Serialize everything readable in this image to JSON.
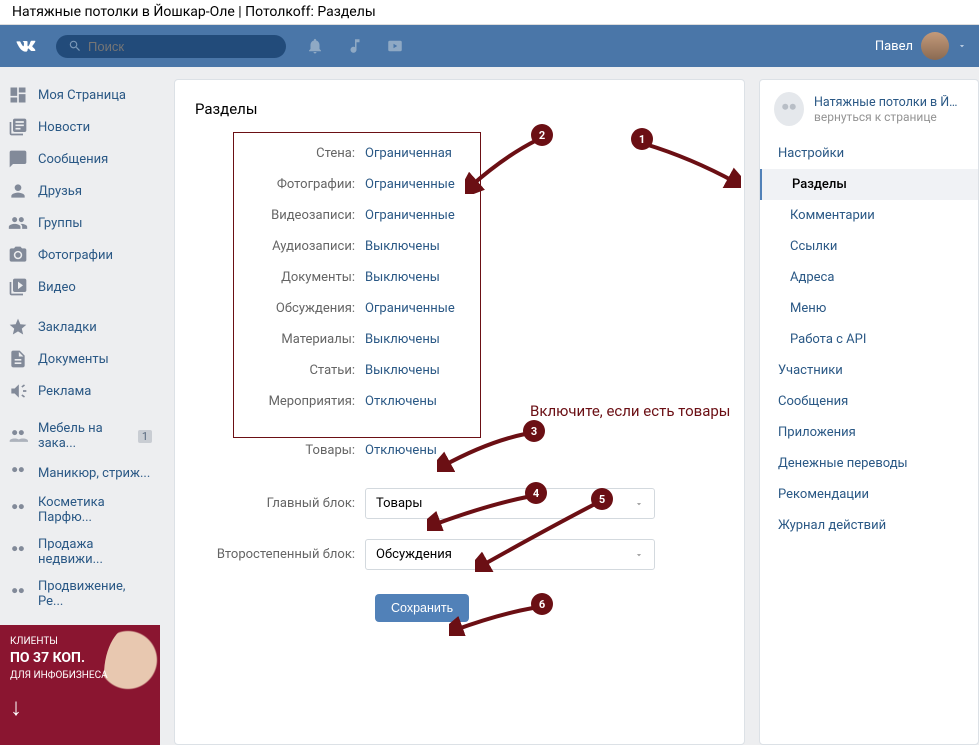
{
  "browser_title": "Натяжные потолки в Йошкар-Оле | Потолкоff: Разделы",
  "topbar": {
    "search_placeholder": "Поиск",
    "username": "Павел"
  },
  "leftnav": {
    "primary": [
      "Моя Страница",
      "Новости",
      "Сообщения",
      "Друзья",
      "Группы",
      "Фотографии",
      "Видео"
    ],
    "secondary": [
      "Закладки",
      "Документы",
      "Реклама"
    ],
    "groups": [
      {
        "label": "Мебель на зака...",
        "badge": "1"
      },
      {
        "label": "Маникюр, стриж..."
      },
      {
        "label": "Косметика Парфю..."
      },
      {
        "label": "Продажа недвижи..."
      },
      {
        "label": "Продвижение, Ре..."
      }
    ]
  },
  "ad": {
    "line1": "КЛИЕНТЫ",
    "line2": "ПО 37 КОП.",
    "line3": "ДЛЯ ИНФОБИЗНЕСА"
  },
  "content": {
    "title": "Разделы",
    "settings": [
      {
        "label": "Стена:",
        "value": "Ограниченная"
      },
      {
        "label": "Фотографии:",
        "value": "Ограниченные"
      },
      {
        "label": "Видеозаписи:",
        "value": "Ограниченные"
      },
      {
        "label": "Аудиозаписи:",
        "value": "Выключены"
      },
      {
        "label": "Документы:",
        "value": "Выключены"
      },
      {
        "label": "Обсуждения:",
        "value": "Ограниченные"
      },
      {
        "label": "Материалы:",
        "value": "Выключены"
      },
      {
        "label": "Статьи:",
        "value": "Выключены"
      },
      {
        "label": "Мероприятия:",
        "value": "Отключены"
      }
    ],
    "products_label": "Товары:",
    "products_value": "Отключены",
    "main_block_label": "Главный блок:",
    "main_block_value": "Товары",
    "secondary_block_label": "Второстепенный блок:",
    "secondary_block_value": "Обсуждения",
    "save": "Сохранить"
  },
  "right": {
    "group_name": "Натяжные потолки в Йо...",
    "back": "вернуться к странице",
    "items": [
      {
        "label": "Настройки",
        "type": "top"
      },
      {
        "label": "Разделы",
        "type": "sub",
        "active": true
      },
      {
        "label": "Комментарии",
        "type": "sub"
      },
      {
        "label": "Ссылки",
        "type": "sub"
      },
      {
        "label": "Адреса",
        "type": "sub"
      },
      {
        "label": "Меню",
        "type": "sub"
      },
      {
        "label": "Работа с API",
        "type": "sub"
      },
      {
        "label": "Участники",
        "type": "top"
      },
      {
        "label": "Сообщения",
        "type": "top"
      },
      {
        "label": "Приложения",
        "type": "top"
      },
      {
        "label": "Денежные переводы",
        "type": "top"
      },
      {
        "label": "Рекомендации",
        "type": "top"
      },
      {
        "label": "Журнал действий",
        "type": "top"
      }
    ]
  },
  "annotations": {
    "tip": "Включите, если есть товары"
  }
}
